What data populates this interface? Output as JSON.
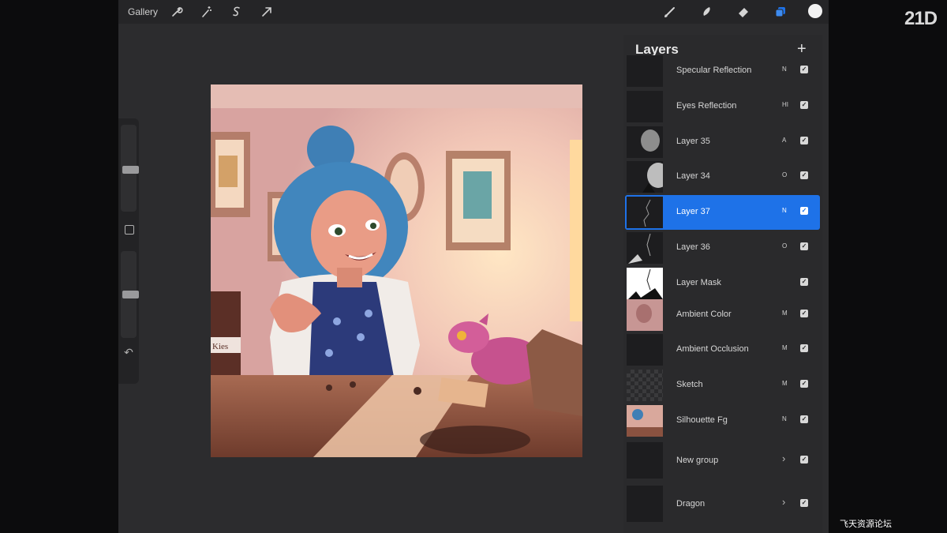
{
  "toolbar": {
    "gallery_label": "Gallery",
    "left_tools": [
      "wrench-icon",
      "magic-wand-icon",
      "selection-icon",
      "transform-arrow-icon"
    ],
    "right_tools": [
      "brush-icon",
      "smudge-icon",
      "eraser-icon",
      "layers-icon"
    ],
    "active_tool": "layers-icon",
    "current_color": "#f2f2f2",
    "accent_color": "#1e72e8"
  },
  "layers_panel": {
    "title": "Layers",
    "add_label": "+",
    "layers": [
      {
        "name": "Specular Reflection",
        "blend": "N",
        "visible": true
      },
      {
        "name": "Eyes Reflection",
        "blend": "HI",
        "visible": true
      },
      {
        "name": "Layer 35",
        "blend": "A",
        "visible": true
      },
      {
        "name": "Layer 34",
        "blend": "O",
        "visible": true
      },
      {
        "name": "Layer 37",
        "blend": "N",
        "visible": true,
        "active": true
      },
      {
        "name": "Layer 36",
        "blend": "O",
        "visible": true
      },
      {
        "name": "Layer Mask",
        "blend": "",
        "visible": true
      },
      {
        "name": "Ambient Color",
        "blend": "M",
        "visible": true
      },
      {
        "name": "Ambient Occlusion",
        "blend": "M",
        "visible": true
      },
      {
        "name": "Sketch",
        "blend": "M",
        "visible": true
      },
      {
        "name": "Silhouette Fg",
        "blend": "N",
        "visible": true
      },
      {
        "name": "New group",
        "blend": "",
        "visible": true,
        "group": true
      },
      {
        "name": "Dragon",
        "blend": "",
        "visible": true,
        "group": true
      }
    ]
  },
  "canvas": {
    "box_label": "Kies"
  },
  "branding": {
    "logo": "21D",
    "watermark": "飞天资源论坛"
  }
}
